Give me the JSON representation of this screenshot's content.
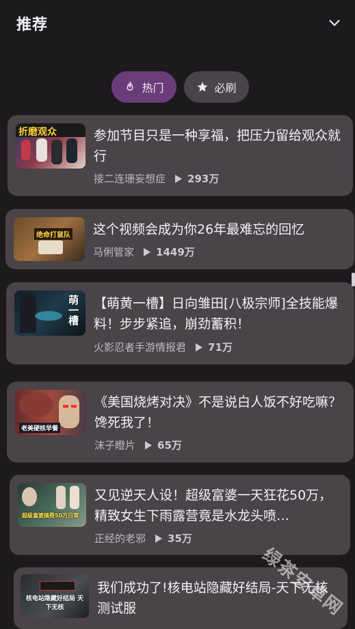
{
  "header": {
    "title": "推荐"
  },
  "tabs": [
    {
      "label": "热门",
      "icon": "fire-icon",
      "active": true
    },
    {
      "label": "必刷",
      "icon": "star-icon",
      "active": false
    }
  ],
  "videos": [
    {
      "title": "参加节目只是一种享福，把压力留给观众就行",
      "author": "接二连珊妄想症",
      "views": "293万",
      "thumb_text": "折磨观众"
    },
    {
      "title": "这个视频会成为你26年最难忘的回忆",
      "author": "马俐管家",
      "views": "1449万",
      "thumb_text": "绝命打鼠队"
    },
    {
      "title": "【萌黄一槽】日向雏田[八极宗师]全技能爆料！步步紧追，崩劲蓄积！",
      "author": "火影忍者手游情报君",
      "views": "71万",
      "thumb_text": "萌一槽"
    },
    {
      "title": "《美国烧烤对决》不是说白人饭不好吃嘛？馋死我了！",
      "author": "沫子瞪片",
      "views": "65万",
      "thumb_text": "老美硬核早餐"
    },
    {
      "title": "又见逆天人设！超级富婆一天狂花50万，精致女生下雨露营竟是水龙头喷…",
      "author": "正经的老邪",
      "views": "35万",
      "thumb_text": "超级富婆搞费50万日常"
    },
    {
      "title": "我们成功了!核电站隐藏好结局-天下无核 测试服",
      "author": "",
      "views": "",
      "thumb_text": "核电站隐藏好结局 天下无核"
    }
  ],
  "watermark": "绿茶安卓网",
  "colors": {
    "background": "#1c1a1d",
    "card": "#4a4348",
    "active_tab": "#6a3c7a",
    "tab": "#4a4349"
  }
}
